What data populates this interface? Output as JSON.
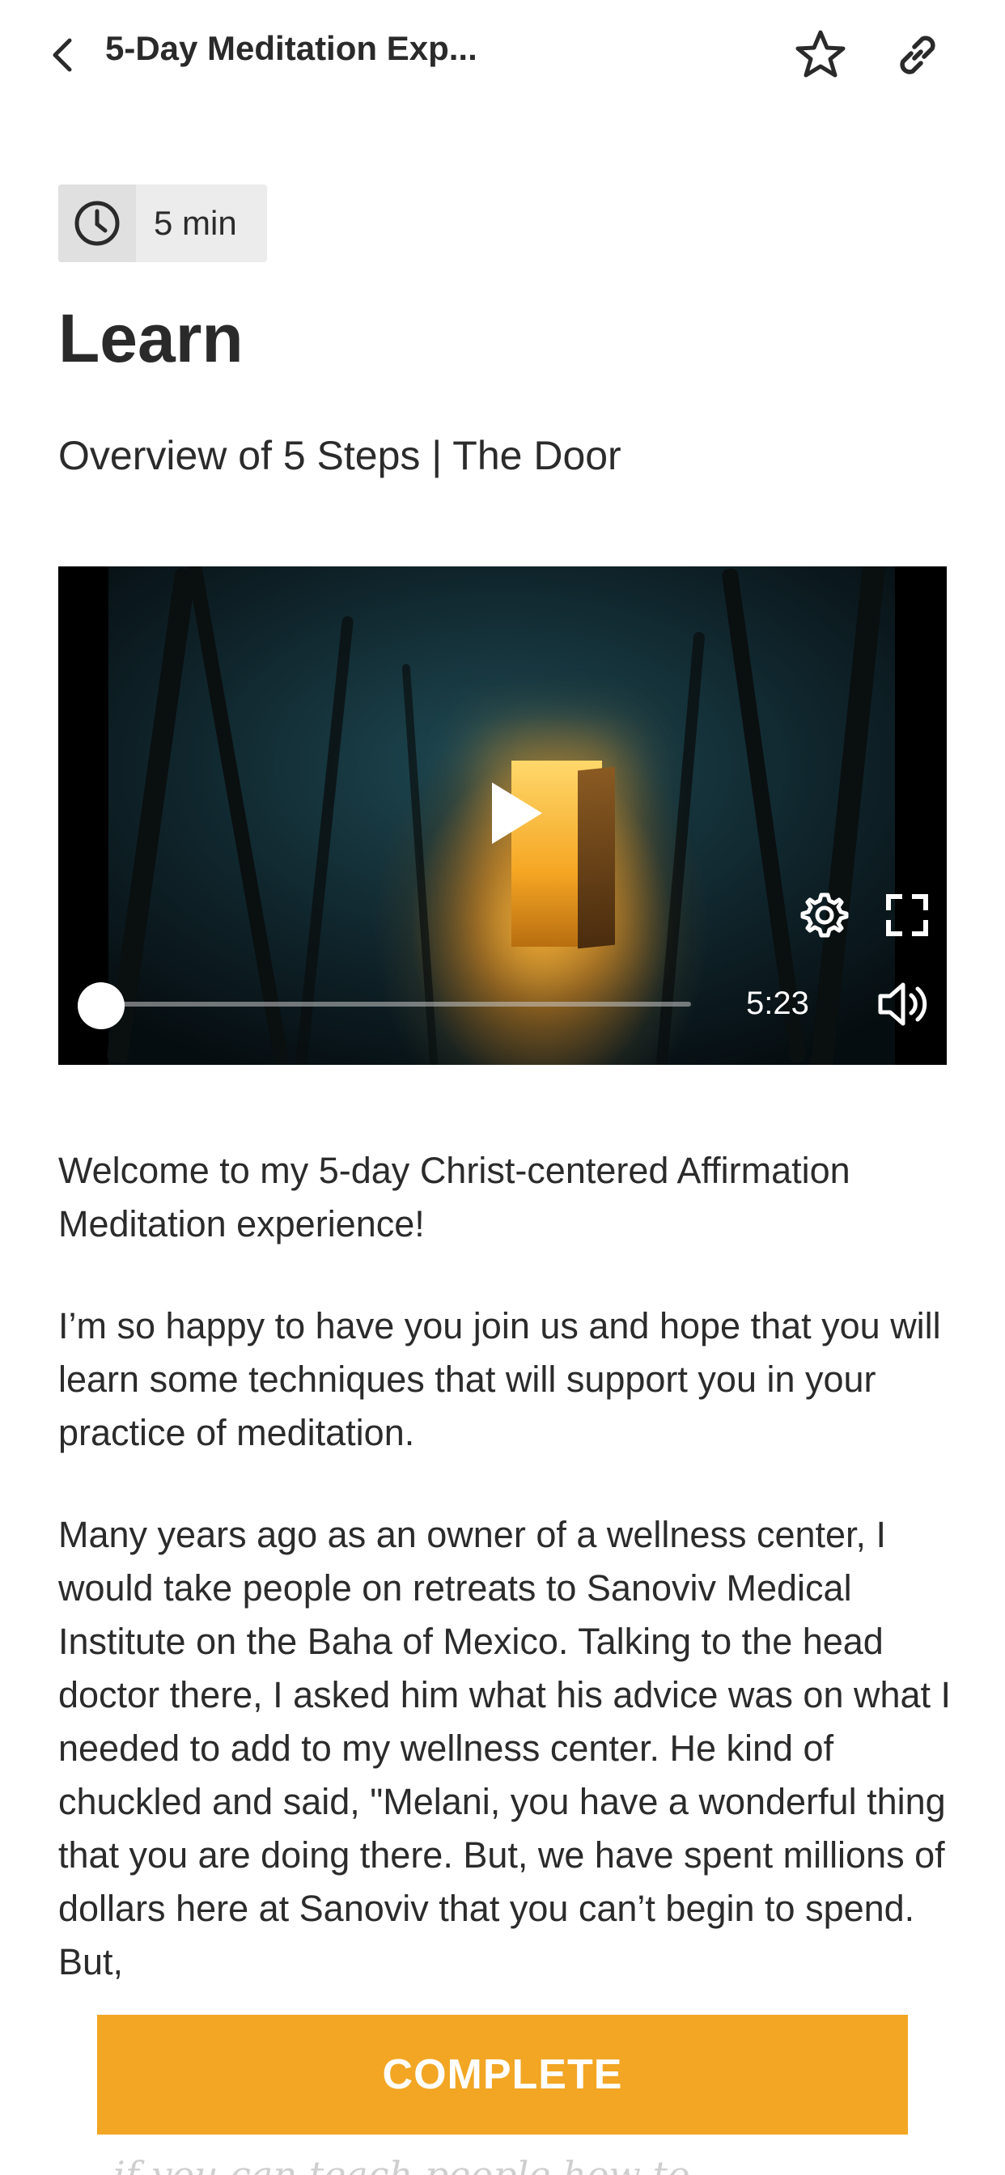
{
  "header": {
    "title": "5-Day Meditation Exp...",
    "back_icon": "chevron-left-icon",
    "favorite_icon": "star-outline-icon",
    "share_icon": "link-icon"
  },
  "lesson": {
    "duration": "5 min",
    "duration_icon": "clock-icon",
    "section_title": "Learn",
    "subtitle": "Overview of 5 Steps | The Door"
  },
  "video": {
    "time_remaining": "5:23",
    "progress": 0,
    "play_icon": "play-icon",
    "settings_icon": "gear-icon",
    "fullscreen_icon": "fullscreen-icon",
    "volume_icon": "volume-icon"
  },
  "body": {
    "paragraphs": [
      "Welcome to my 5-day Christ-centered Affirmation Meditation experience!",
      "I’m so happy to have you join us and hope that you will learn some techniques that will support you in your practice of meditation.",
      "Many years ago as an owner of a wellness center, I would take people on retreats to Sanoviv Medical Institute on the Baha of Mexico. Talking to the head doctor there, I asked him what his advice was on what I needed to add to my wellness center. He kind of chuckled and said, \"Melani, you have a wonderful thing that you are doing there. But, we have spent millions of dollars here at Sanoviv that you can’t begin to spend. But,"
    ],
    "peek_text": "if you can teach people how to"
  },
  "actions": {
    "complete_label": "COMPLETE"
  },
  "colors": {
    "accent": "#f2a624",
    "text": "#2b2b2b",
    "badge_bg": "#ececec"
  }
}
